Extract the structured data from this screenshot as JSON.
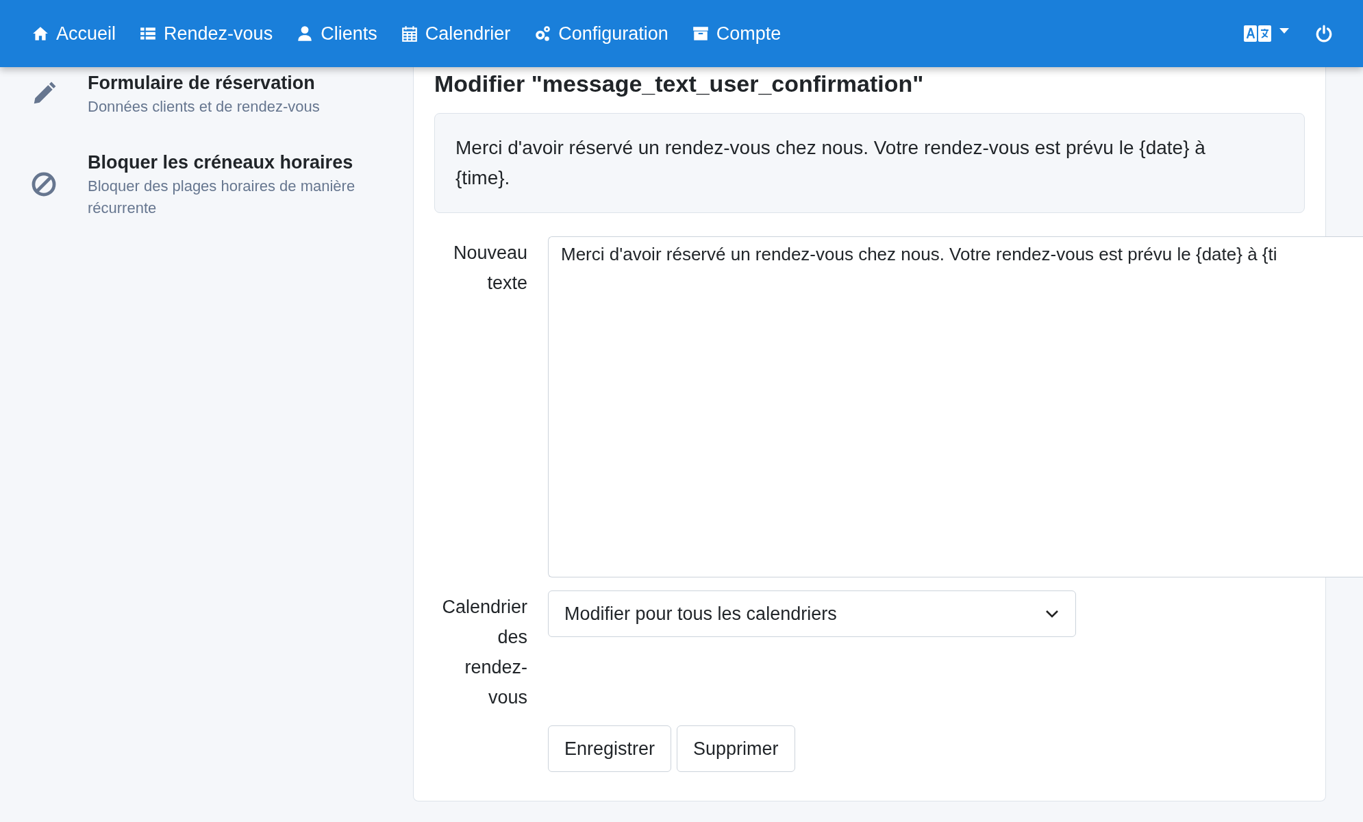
{
  "navbar": {
    "items": [
      {
        "label": "Accueil"
      },
      {
        "label": "Rendez-vous"
      },
      {
        "label": "Clients"
      },
      {
        "label": "Calendrier"
      },
      {
        "label": "Configuration"
      },
      {
        "label": "Compte"
      }
    ]
  },
  "sidebar": {
    "items": [
      {
        "title": "Formulaire de réservation",
        "subtitle": "Données clients et de rendez-vous"
      },
      {
        "title": "Bloquer les créneaux horaires",
        "subtitle": "Bloquer des plages horaires de manière récurrente"
      }
    ]
  },
  "main": {
    "title": "Modifier \"message_text_user_confirmation\"",
    "current_text": "Merci d'avoir réservé un rendez-vous chez nous. Votre rendez-vous est prévu le {date} à {time}.",
    "form": {
      "new_text_label": "Nouveau texte",
      "new_text_value": "Merci d'avoir réservé un rendez-vous chez nous. Votre rendez-vous est prévu le {date} à {ti",
      "calendar_label": "Calendrier des rendez-vous",
      "calendar_value": "Modifier pour tous les calendriers"
    },
    "buttons": [
      "Enregistrer",
      "Supprimer"
    ]
  }
}
